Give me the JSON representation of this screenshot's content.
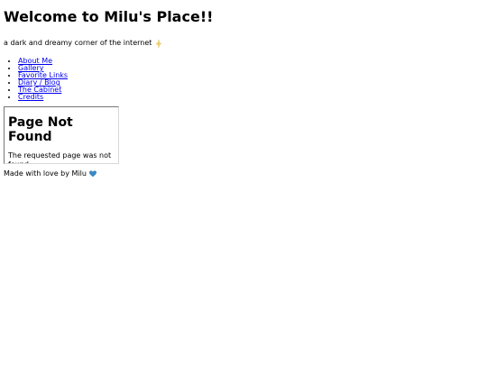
{
  "header": {
    "title": "Welcome to Milu's Place!!",
    "tagline": "a dark and dreamy corner of the internet"
  },
  "nav": {
    "items": [
      {
        "label": "About Me"
      },
      {
        "label": "Gallery"
      },
      {
        "label": "Favorite Links"
      },
      {
        "label": "Diary / Blog"
      },
      {
        "label": "The Cabinet"
      },
      {
        "label": "Credits"
      }
    ]
  },
  "frame": {
    "title": "Page Not Found",
    "message": "The requested page was not found."
  },
  "footer": {
    "text": "Made with love by Milu"
  },
  "icons": {
    "tagline_icon": "sparkle-icon",
    "footer_icon": "blue-heart-icon"
  },
  "colors": {
    "link": "#0000ee",
    "heart": "#3b88c3",
    "sparkle": "#f4d35e"
  }
}
